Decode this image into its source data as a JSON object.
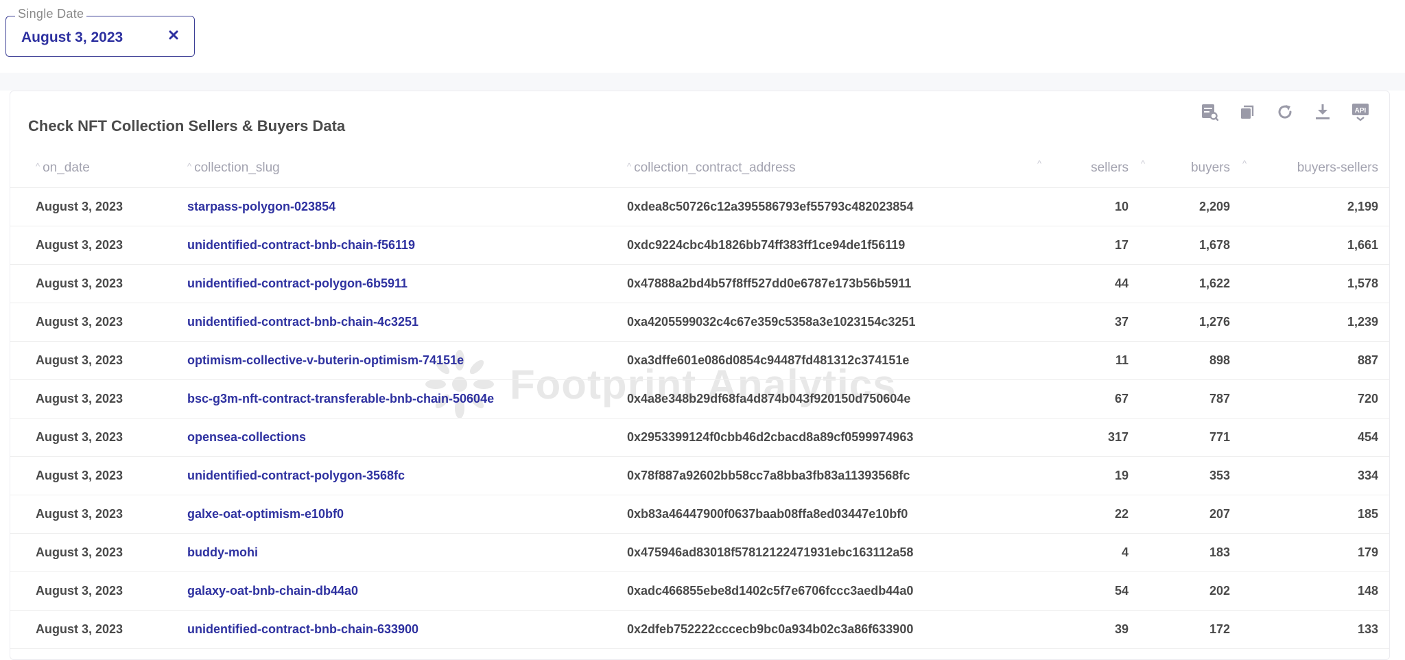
{
  "filter": {
    "legend": "Single Date",
    "value": "August 3, 2023",
    "clear_label": "×"
  },
  "card": {
    "title": "Check NFT Collection Sellers & Buyers Data",
    "toolbar": [
      {
        "name": "view-sql-icon"
      },
      {
        "name": "duplicate-icon"
      },
      {
        "name": "refresh-icon"
      },
      {
        "name": "download-icon"
      },
      {
        "name": "api-icon",
        "label": "API"
      }
    ],
    "watermark": "Footprint Analytics"
  },
  "colors": {
    "accent": "#2e31a0",
    "text": "#4a4a4a",
    "header_text": "#a3a3b0",
    "border": "#eeeeee"
  },
  "table": {
    "columns": [
      "on_date",
      "collection_slug",
      "collection_contract_address",
      "sellers",
      "buyers",
      "buyers-sellers"
    ],
    "rows": [
      [
        "August 3, 2023",
        "starpass-polygon-023854",
        "0xdea8c50726c12a395586793ef55793c482023854",
        "10",
        "2,209",
        "2,199"
      ],
      [
        "August 3, 2023",
        "unidentified-contract-bnb-chain-f56119",
        "0xdc9224cbc4b1826bb74ff383ff1ce94de1f56119",
        "17",
        "1,678",
        "1,661"
      ],
      [
        "August 3, 2023",
        "unidentified-contract-polygon-6b5911",
        "0x47888a2bd4b57f8ff527dd0e6787e173b56b5911",
        "44",
        "1,622",
        "1,578"
      ],
      [
        "August 3, 2023",
        "unidentified-contract-bnb-chain-4c3251",
        "0xa4205599032c4c67e359c5358a3e1023154c3251",
        "37",
        "1,276",
        "1,239"
      ],
      [
        "August 3, 2023",
        "optimism-collective-v-buterin-optimism-74151e",
        "0xa3dffe601e086d0854c94487fd481312c374151e",
        "11",
        "898",
        "887"
      ],
      [
        "August 3, 2023",
        "bsc-g3m-nft-contract-transferable-bnb-chain-50604e",
        "0x4a8e348b29df68fa4d874b043f920150d750604e",
        "67",
        "787",
        "720"
      ],
      [
        "August 3, 2023",
        "opensea-collections",
        "0x2953399124f0cbb46d2cbacd8a89cf0599974963",
        "317",
        "771",
        "454"
      ],
      [
        "August 3, 2023",
        "unidentified-contract-polygon-3568fc",
        "0x78f887a92602bb58cc7a8bba3fb83a11393568fc",
        "19",
        "353",
        "334"
      ],
      [
        "August 3, 2023",
        "galxe-oat-optimism-e10bf0",
        "0xb83a46447900f0637baab08ffa8ed03447e10bf0",
        "22",
        "207",
        "185"
      ],
      [
        "August 3, 2023",
        "buddy-mohi",
        "0x475946ad83018f57812122471931ebc163112a58",
        "4",
        "183",
        "179"
      ],
      [
        "August 3, 2023",
        "galaxy-oat-bnb-chain-db44a0",
        "0xadc466855ebe8d1402c5f7e6706fccc3aedb44a0",
        "54",
        "202",
        "148"
      ],
      [
        "August 3, 2023",
        "unidentified-contract-bnb-chain-633900",
        "0x2dfeb752222cccecb9bc0a934b02c3a86f633900",
        "39",
        "172",
        "133"
      ]
    ]
  }
}
